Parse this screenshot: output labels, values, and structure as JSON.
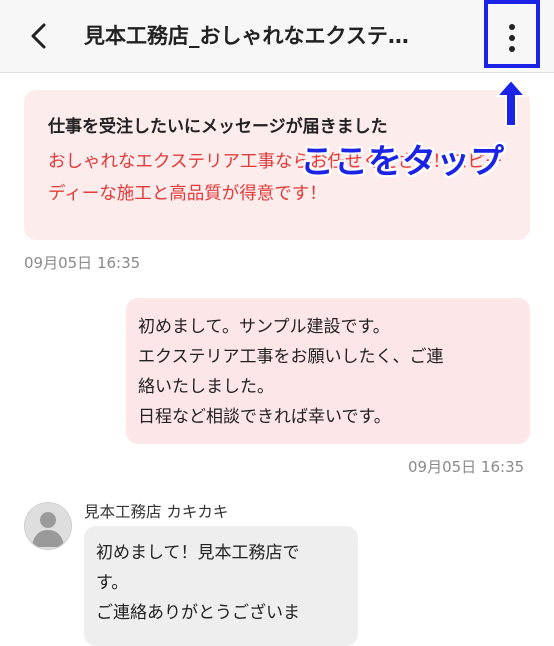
{
  "header": {
    "title": "見本工務店_おしゃれなエクステ…"
  },
  "annotation": {
    "label": "ここをタップ",
    "color": "#1a23e6"
  },
  "notice": {
    "title": "仕事を受注したいにメッセージが届きました",
    "body": "おしゃれなエクステリア工事ならお任せください！スピーディーな施工と高品質が得意です！",
    "body_color": "#e23a3a",
    "timestamp": "09月05日 16:35"
  },
  "sent_message": {
    "lines": [
      "初めまして。サンプル建設です。",
      "エクステリア工事をお願いしたく、ご連",
      "絡いたしました。",
      "日程など相談できれば幸いです。"
    ],
    "timestamp": "09月05日 16:35"
  },
  "received_message": {
    "sender": "見本工務店 カキカキ",
    "lines": [
      "初めまして！見本工務店で",
      "す。",
      "ご連絡ありがとうございま"
    ]
  }
}
